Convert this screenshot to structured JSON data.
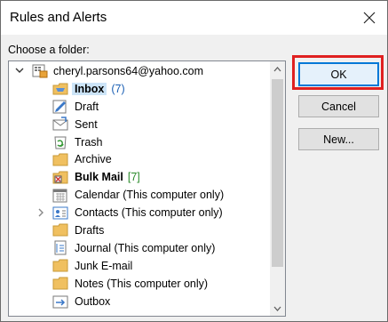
{
  "window": {
    "title": "Rules and Alerts"
  },
  "folder_prompt": "Choose a folder:",
  "account": {
    "name": "cheryl.parsons64@yahoo.com"
  },
  "folders": [
    {
      "label": "Inbox",
      "count": "(7)",
      "bold": true,
      "icon": "inbox-icon"
    },
    {
      "label": "Draft",
      "icon": "draft-icon"
    },
    {
      "label": "Sent",
      "icon": "sent-icon"
    },
    {
      "label": "Trash",
      "icon": "trash-icon"
    },
    {
      "label": "Archive",
      "icon": "folder-icon"
    },
    {
      "label": "Bulk Mail",
      "count": "[7]",
      "bold": true,
      "icon": "bulk-mail-icon"
    },
    {
      "label": "Calendar (This computer only)",
      "icon": "calendar-icon"
    },
    {
      "label": "Contacts (This computer only)",
      "icon": "contacts-icon"
    },
    {
      "label": "Drafts",
      "icon": "folder-icon"
    },
    {
      "label": "Journal (This computer only)",
      "icon": "journal-icon"
    },
    {
      "label": "Junk E-mail",
      "icon": "folder-icon"
    },
    {
      "label": "Notes (This computer only)",
      "icon": "folder-icon"
    },
    {
      "label": "Outbox",
      "icon": "outbox-icon"
    }
  ],
  "buttons": {
    "ok": "OK",
    "cancel": "Cancel",
    "new": "New..."
  },
  "colors": {
    "selection": "#cce4f7",
    "ok_border": "#0078d7",
    "highlight": "#e02020",
    "count_blue": "#1a5fb4",
    "count_green": "#2a8a2a"
  }
}
